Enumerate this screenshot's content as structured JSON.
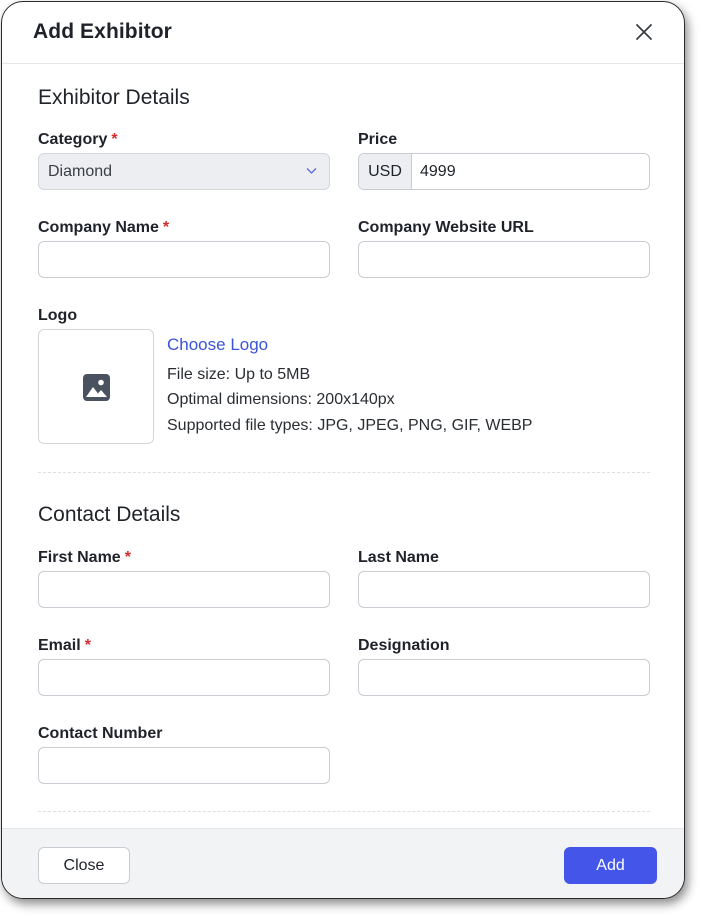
{
  "modal": {
    "title": "Add Exhibitor"
  },
  "exhibitor_details": {
    "section_title": "Exhibitor Details",
    "category": {
      "label": "Category",
      "required_mark": "*",
      "value": "Diamond"
    },
    "price": {
      "label": "Price",
      "currency": "USD",
      "value": "4999"
    },
    "company_name": {
      "label": "Company Name",
      "required_mark": "*",
      "value": ""
    },
    "company_website": {
      "label": "Company Website URL",
      "value": ""
    },
    "logo": {
      "label": "Logo",
      "choose_label": "Choose Logo",
      "file_size": "File size: Up to 5MB",
      "dimensions": "Optimal dimensions: 200x140px",
      "file_types": "Supported file types: JPG, JPEG, PNG, GIF, WEBP"
    }
  },
  "contact_details": {
    "section_title": "Contact Details",
    "first_name": {
      "label": "First Name",
      "required_mark": "*",
      "value": ""
    },
    "last_name": {
      "label": "Last Name",
      "value": ""
    },
    "email": {
      "label": "Email",
      "required_mark": "*",
      "value": ""
    },
    "designation": {
      "label": "Designation",
      "value": ""
    },
    "contact_number": {
      "label": "Contact Number",
      "value": ""
    }
  },
  "footer": {
    "close_label": "Close",
    "add_label": "Add"
  },
  "colors": {
    "primary": "#4455ea",
    "link": "#3b54d6",
    "required": "#d42a2a"
  },
  "icons": {
    "close": "close-icon",
    "chevron": "chevron-down-icon",
    "image": "image-icon"
  }
}
